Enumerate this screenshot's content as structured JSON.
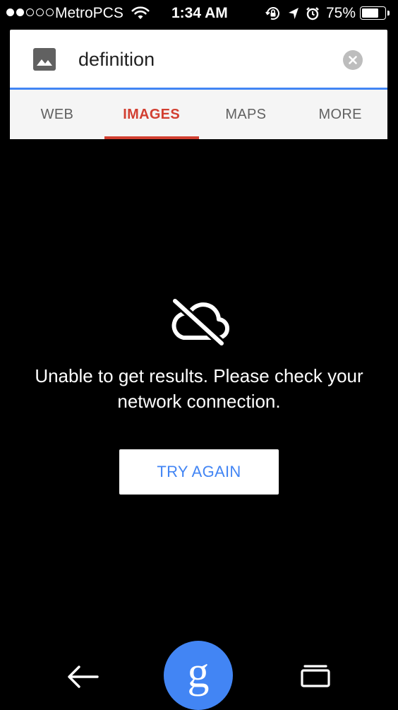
{
  "status_bar": {
    "signal_filled": 2,
    "signal_total": 5,
    "carrier": "MetroPCS",
    "time": "1:34 AM",
    "battery_text": "75%",
    "battery_level": 0.75,
    "icons": [
      "wifi-icon",
      "rotation-lock-icon",
      "location-arrow-icon",
      "alarm-icon",
      "battery-icon"
    ]
  },
  "search": {
    "query": "definition",
    "icon": "image-icon",
    "clear_icon": "clear-icon",
    "accent_color": "#4285f4"
  },
  "tabs": [
    {
      "label": "WEB",
      "active": false
    },
    {
      "label": "IMAGES",
      "active": true
    },
    {
      "label": "MAPS",
      "active": false
    },
    {
      "label": "MORE",
      "active": false
    }
  ],
  "tab_active_color": "#d23f31",
  "error": {
    "icon": "cloud-off-icon",
    "message": "Unable to get results. Please check your network connection.",
    "retry_label": "TRY AGAIN",
    "retry_color": "#4285f4"
  },
  "bottom_nav": {
    "back_icon": "back-arrow-icon",
    "fab_label": "g",
    "fab_color": "#4285f4",
    "recents_icon": "recents-icon"
  }
}
